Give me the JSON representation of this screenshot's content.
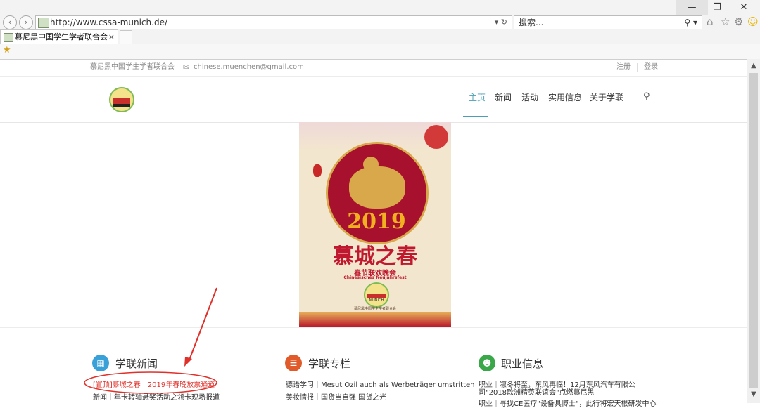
{
  "browser": {
    "url": "http://www.cssa-munich.de/",
    "search_placeholder": "搜索...",
    "tab_title": "慕尼黑中国学生学者联合会",
    "tab_close": "×",
    "address_controls": "▾ ↻",
    "search_controls": "⚲ ▾"
  },
  "topbar": {
    "org_name": "慕尼黑中国学生学者联合会",
    "email": "chinese.muenchen@gmail.com",
    "register": "注册",
    "login": "登录"
  },
  "nav": {
    "items": [
      "主页",
      "新闻",
      "活动",
      "实用信息",
      "关于学联"
    ],
    "active": "主页",
    "accent": "#4a9fb5"
  },
  "poster": {
    "year": "2019",
    "title": "慕城之春",
    "subtitle": "春节联欢晚会",
    "subtitle_de": "Chinesisches Neujahrsfest",
    "logo_text": "MUNICH",
    "footer": "慕尼黑中国学生学者联合会"
  },
  "columns": [
    {
      "title": "学联新闻",
      "icon": "grid-icon",
      "icon_color": "#3aa0d8",
      "items": [
        {
          "text": "[置顶]慕城之春｜2019年春晚放票通道",
          "highlight": true
        },
        {
          "text": "新闻｜年卡转轴悬奖活动之领卡现场报道",
          "highlight": false
        }
      ]
    },
    {
      "title": "学联专栏",
      "icon": "list-icon",
      "icon_color": "#e05a2a",
      "items": [
        {
          "text": "德语学习｜Mesut Özil auch als Werbeträger umstritten",
          "highlight": false
        },
        {
          "text": "美妆情报｜国货当自强 国货之光",
          "highlight": false
        }
      ]
    },
    {
      "title": "职业信息",
      "icon": "users-icon",
      "icon_color": "#3aa84a",
      "items": [
        {
          "text": "职业｜凛冬将至，东风再临！12月东风汽车有限公",
          "highlight": false
        },
        {
          "text": "司\"2018欧洲精英联谊会\"点燃慕尼黑",
          "highlight": false
        },
        {
          "text": "职业｜寻找CE医疗\"设备具博士\"，此行将宏天根研发中心",
          "highlight": false
        }
      ]
    }
  ],
  "annotation": {
    "color": "#e0302a"
  }
}
